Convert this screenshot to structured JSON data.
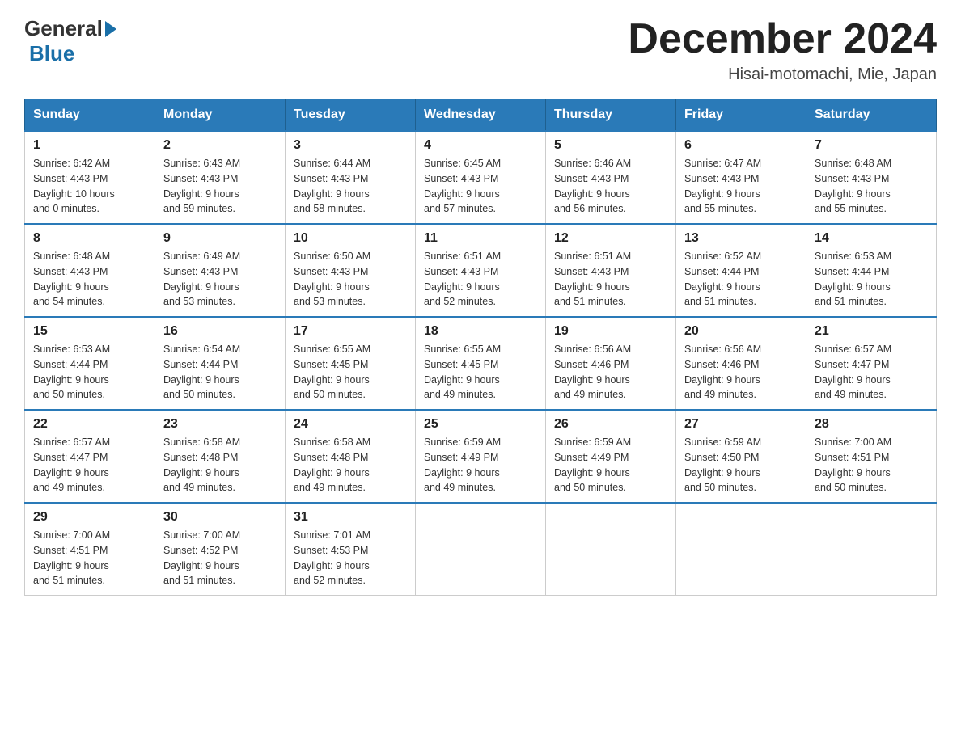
{
  "header": {
    "logo_general": "General",
    "logo_blue": "Blue",
    "month_title": "December 2024",
    "location": "Hisai-motomachi, Mie, Japan"
  },
  "days_of_week": [
    "Sunday",
    "Monday",
    "Tuesday",
    "Wednesday",
    "Thursday",
    "Friday",
    "Saturday"
  ],
  "weeks": [
    [
      {
        "day": "1",
        "sunrise": "6:42 AM",
        "sunset": "4:43 PM",
        "daylight_hours": "10",
        "daylight_minutes": "0"
      },
      {
        "day": "2",
        "sunrise": "6:43 AM",
        "sunset": "4:43 PM",
        "daylight_hours": "9",
        "daylight_minutes": "59"
      },
      {
        "day": "3",
        "sunrise": "6:44 AM",
        "sunset": "4:43 PM",
        "daylight_hours": "9",
        "daylight_minutes": "58"
      },
      {
        "day": "4",
        "sunrise": "6:45 AM",
        "sunset": "4:43 PM",
        "daylight_hours": "9",
        "daylight_minutes": "57"
      },
      {
        "day": "5",
        "sunrise": "6:46 AM",
        "sunset": "4:43 PM",
        "daylight_hours": "9",
        "daylight_minutes": "56"
      },
      {
        "day": "6",
        "sunrise": "6:47 AM",
        "sunset": "4:43 PM",
        "daylight_hours": "9",
        "daylight_minutes": "55"
      },
      {
        "day": "7",
        "sunrise": "6:48 AM",
        "sunset": "4:43 PM",
        "daylight_hours": "9",
        "daylight_minutes": "55"
      }
    ],
    [
      {
        "day": "8",
        "sunrise": "6:48 AM",
        "sunset": "4:43 PM",
        "daylight_hours": "9",
        "daylight_minutes": "54"
      },
      {
        "day": "9",
        "sunrise": "6:49 AM",
        "sunset": "4:43 PM",
        "daylight_hours": "9",
        "daylight_minutes": "53"
      },
      {
        "day": "10",
        "sunrise": "6:50 AM",
        "sunset": "4:43 PM",
        "daylight_hours": "9",
        "daylight_minutes": "53"
      },
      {
        "day": "11",
        "sunrise": "6:51 AM",
        "sunset": "4:43 PM",
        "daylight_hours": "9",
        "daylight_minutes": "52"
      },
      {
        "day": "12",
        "sunrise": "6:51 AM",
        "sunset": "4:43 PM",
        "daylight_hours": "9",
        "daylight_minutes": "51"
      },
      {
        "day": "13",
        "sunrise": "6:52 AM",
        "sunset": "4:44 PM",
        "daylight_hours": "9",
        "daylight_minutes": "51"
      },
      {
        "day": "14",
        "sunrise": "6:53 AM",
        "sunset": "4:44 PM",
        "daylight_hours": "9",
        "daylight_minutes": "51"
      }
    ],
    [
      {
        "day": "15",
        "sunrise": "6:53 AM",
        "sunset": "4:44 PM",
        "daylight_hours": "9",
        "daylight_minutes": "50"
      },
      {
        "day": "16",
        "sunrise": "6:54 AM",
        "sunset": "4:44 PM",
        "daylight_hours": "9",
        "daylight_minutes": "50"
      },
      {
        "day": "17",
        "sunrise": "6:55 AM",
        "sunset": "4:45 PM",
        "daylight_hours": "9",
        "daylight_minutes": "50"
      },
      {
        "day": "18",
        "sunrise": "6:55 AM",
        "sunset": "4:45 PM",
        "daylight_hours": "9",
        "daylight_minutes": "49"
      },
      {
        "day": "19",
        "sunrise": "6:56 AM",
        "sunset": "4:46 PM",
        "daylight_hours": "9",
        "daylight_minutes": "49"
      },
      {
        "day": "20",
        "sunrise": "6:56 AM",
        "sunset": "4:46 PM",
        "daylight_hours": "9",
        "daylight_minutes": "49"
      },
      {
        "day": "21",
        "sunrise": "6:57 AM",
        "sunset": "4:47 PM",
        "daylight_hours": "9",
        "daylight_minutes": "49"
      }
    ],
    [
      {
        "day": "22",
        "sunrise": "6:57 AM",
        "sunset": "4:47 PM",
        "daylight_hours": "9",
        "daylight_minutes": "49"
      },
      {
        "day": "23",
        "sunrise": "6:58 AM",
        "sunset": "4:48 PM",
        "daylight_hours": "9",
        "daylight_minutes": "49"
      },
      {
        "day": "24",
        "sunrise": "6:58 AM",
        "sunset": "4:48 PM",
        "daylight_hours": "9",
        "daylight_minutes": "49"
      },
      {
        "day": "25",
        "sunrise": "6:59 AM",
        "sunset": "4:49 PM",
        "daylight_hours": "9",
        "daylight_minutes": "49"
      },
      {
        "day": "26",
        "sunrise": "6:59 AM",
        "sunset": "4:49 PM",
        "daylight_hours": "9",
        "daylight_minutes": "50"
      },
      {
        "day": "27",
        "sunrise": "6:59 AM",
        "sunset": "4:50 PM",
        "daylight_hours": "9",
        "daylight_minutes": "50"
      },
      {
        "day": "28",
        "sunrise": "7:00 AM",
        "sunset": "4:51 PM",
        "daylight_hours": "9",
        "daylight_minutes": "50"
      }
    ],
    [
      {
        "day": "29",
        "sunrise": "7:00 AM",
        "sunset": "4:51 PM",
        "daylight_hours": "9",
        "daylight_minutes": "51"
      },
      {
        "day": "30",
        "sunrise": "7:00 AM",
        "sunset": "4:52 PM",
        "daylight_hours": "9",
        "daylight_minutes": "51"
      },
      {
        "day": "31",
        "sunrise": "7:01 AM",
        "sunset": "4:53 PM",
        "daylight_hours": "9",
        "daylight_minutes": "52"
      },
      null,
      null,
      null,
      null
    ]
  ],
  "labels": {
    "sunrise": "Sunrise:",
    "sunset": "Sunset:",
    "daylight": "Daylight:",
    "hours_suffix": "hours",
    "and": "and",
    "minutes_suffix": "minutes."
  }
}
